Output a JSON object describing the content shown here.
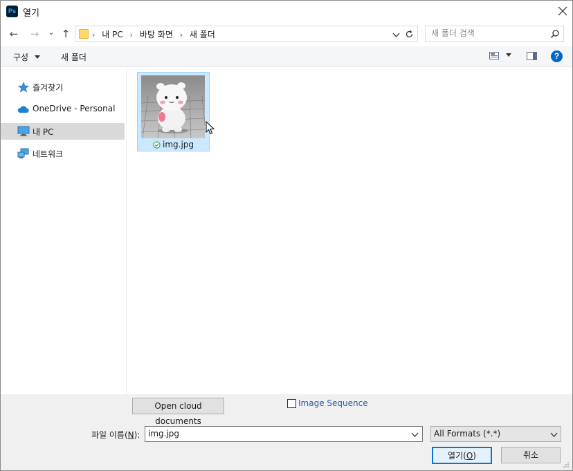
{
  "window": {
    "title": "열기",
    "app_icon": "Ps"
  },
  "nav": {
    "back": "←",
    "forward": "→",
    "recent": "⌄",
    "up": "↑"
  },
  "address": {
    "crumbs": [
      "내 PC",
      "바탕 화면",
      "새 폴더"
    ],
    "separator": "›"
  },
  "search": {
    "placeholder": "새 폴더 검색"
  },
  "toolbar": {
    "organize_label": "구성",
    "new_folder_label": "새 폴더",
    "help_label": "?"
  },
  "sidebar": {
    "items": [
      {
        "label": "즐겨찾기",
        "icon": "star-icon"
      },
      {
        "label": "OneDrive - Personal",
        "icon": "cloud-icon"
      },
      {
        "label": "내 PC",
        "icon": "computer-icon",
        "selected": true
      },
      {
        "label": "네트워크",
        "icon": "network-icon"
      }
    ]
  },
  "files": [
    {
      "name": "img.jpg",
      "status_icon": "sync-ok-icon",
      "selected": true
    }
  ],
  "bottom": {
    "cloud_button": "Open cloud documents",
    "image_sequence_label": "Image Sequence",
    "image_sequence_checked": false,
    "filename_label_prefix": "파일 이름(",
    "filename_label_key": "N",
    "filename_label_suffix": "):",
    "filename_value": "img.jpg",
    "format_value": "All Formats (*.*)",
    "open_label_prefix": "열기(",
    "open_label_key": "O",
    "open_label_suffix": ")",
    "cancel_label": "취소"
  },
  "colors": {
    "accent": "#0078d7",
    "selection": "#cce8ff",
    "link": "#2a5ba8"
  }
}
